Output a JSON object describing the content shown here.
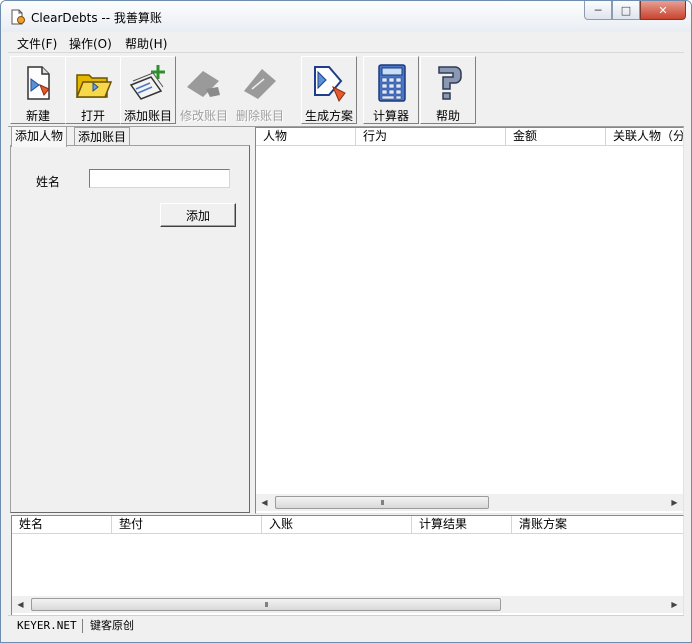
{
  "window": {
    "title": "ClearDebts -- 我善算账"
  },
  "menu": [
    "文件(F)",
    "操作(O)",
    "帮助(H)"
  ],
  "toolbar": [
    {
      "label": "新建",
      "icon": "new-file-icon",
      "enabled": true
    },
    {
      "label": "打开",
      "icon": "open-folder-icon",
      "enabled": true
    },
    {
      "label": "添加账目",
      "icon": "add-entry-icon",
      "enabled": true
    },
    {
      "label": "修改账目",
      "icon": "edit-entry-icon",
      "enabled": false
    },
    {
      "label": "删除账目",
      "icon": "delete-entry-icon",
      "enabled": false
    },
    {
      "label": "生成方案",
      "icon": "generate-plan-icon",
      "enabled": true
    },
    {
      "label": "计算器",
      "icon": "calculator-icon",
      "enabled": true
    },
    {
      "label": "帮助",
      "icon": "help-icon",
      "enabled": true
    }
  ],
  "tabs": [
    {
      "label": "添加人物",
      "active": true
    },
    {
      "label": "添加账目",
      "active": false
    }
  ],
  "add_person": {
    "name_label": "姓名",
    "name_value": "",
    "add_button": "添加"
  },
  "entries_table": {
    "columns": [
      "人物",
      "行为",
      "金额",
      "关联人物（分"
    ],
    "rows": []
  },
  "results_table": {
    "columns": [
      "姓名",
      "垫付",
      "入账",
      "计算结果",
      "清账方案"
    ],
    "rows": []
  },
  "scroll_glyph": "III",
  "status": {
    "site": "KEYER.NET",
    "text": "键客原创"
  },
  "colors": {
    "titlebar": "#e9edf3",
    "close_button": "#c8432e",
    "face": "#f0f0f0"
  }
}
